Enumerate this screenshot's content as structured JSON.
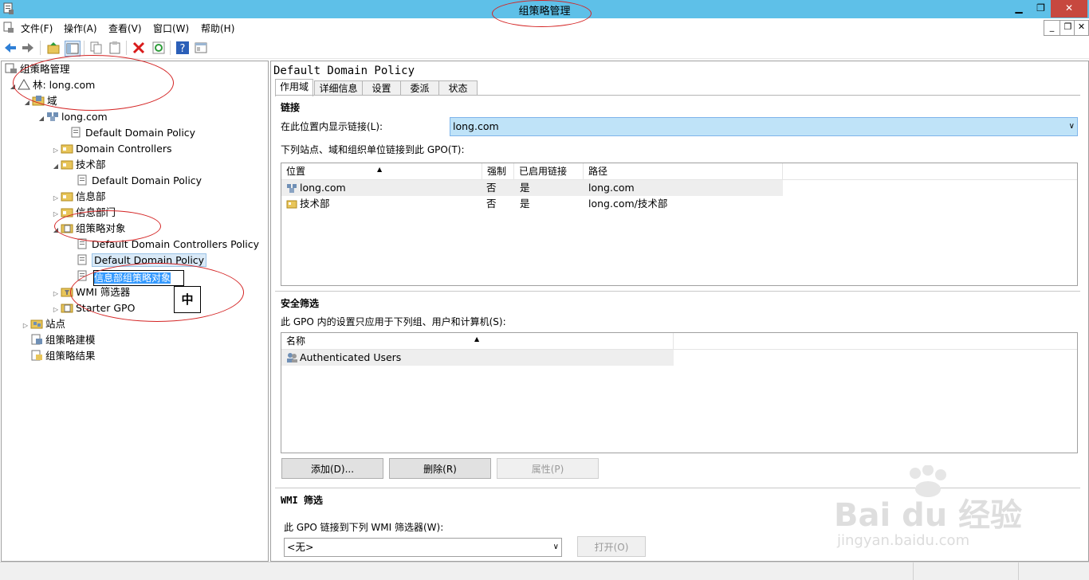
{
  "window": {
    "title": "组策略管理",
    "controls": {
      "minimize": "▁",
      "maximize": "❐",
      "close": "✕"
    }
  },
  "menu": [
    "文件(F)",
    "操作(A)",
    "查看(V)",
    "窗口(W)",
    "帮助(H)"
  ],
  "mdi_controls": {
    "minimize": "_",
    "restore": "❐",
    "close": "✕"
  },
  "toolbar": {
    "icons": [
      "back-arrow-icon",
      "forward-arrow-icon",
      "folder-up-icon",
      "show-hide-tree-icon",
      "copy-icon",
      "paste-icon",
      "delete-icon",
      "refresh-icon",
      "help-icon",
      "properties-icon"
    ]
  },
  "tree": {
    "root": "组策略管理",
    "forest": "林: long.com",
    "domains": "域",
    "domain": "long.com",
    "default_domain_policy": "Default Domain Policy",
    "domain_controllers": "Domain Controllers",
    "ou_tech": "技术部",
    "ou_tech_policy": "Default Domain Policy",
    "ou_info": "信息部",
    "ou_info_dept": "信息部门",
    "gpo_objects": "组策略对象",
    "gpo_dc_policy": "Default Domain Controllers Policy",
    "gpo_default_policy": "Default Domain Policy",
    "gpo_new_edit": "信息部组策略对象",
    "wmi_filters": "WMI 筛选器",
    "starter_gpo": "Starter GPO",
    "sites": "站点",
    "modeling": "组策略建模",
    "results": "组策略结果"
  },
  "ime_indicator": "中",
  "details": {
    "title": "Default Domain Policy",
    "tabs": [
      "作用域",
      "详细信息",
      "设置",
      "委派",
      "状态"
    ],
    "links": {
      "section": "链接",
      "location_label": "在此位置内显示链接(L):",
      "location_value": "long.com",
      "list_label": "下列站点、域和组织单位链接到此 GPO(T):",
      "columns": [
        "位置",
        "强制",
        "已启用链接",
        "路径"
      ],
      "rows": [
        {
          "location": "long.com",
          "enforced": "否",
          "enabled": "是",
          "path": "long.com"
        },
        {
          "location": "技术部",
          "enforced": "否",
          "enabled": "是",
          "path": "long.com/技术部"
        }
      ]
    },
    "security": {
      "section": "安全筛选",
      "label": "此 GPO 内的设置只应用于下列组、用户和计算机(S):",
      "columns": [
        "名称"
      ],
      "rows": [
        "Authenticated Users"
      ],
      "buttons": {
        "add": "添加(D)...",
        "remove": "删除(R)",
        "properties": "属性(P)"
      }
    },
    "wmi": {
      "section": "WMI 筛选",
      "label": "此 GPO 链接到下列 WMI 筛选器(W):",
      "value": "<无>",
      "open": "打开(O)"
    }
  },
  "watermark": {
    "brand": "Bai du 经验",
    "url": "jingyan.baidu.com"
  },
  "colors": {
    "titlebar": "#5ec0e8",
    "close": "#c7483f",
    "selection": "#3399ff",
    "combo": "#bfe3f8",
    "annotation": "#d42424"
  }
}
